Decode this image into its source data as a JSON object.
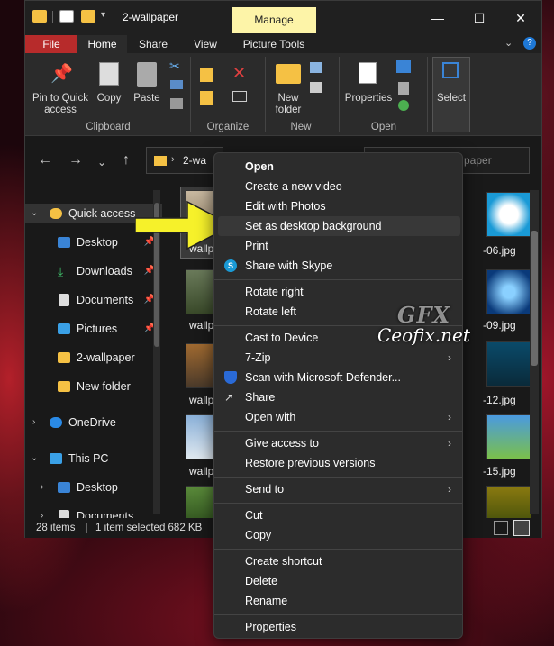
{
  "window": {
    "title": "2-wallpaper",
    "contextual_tab": "Manage"
  },
  "tabs": [
    "File",
    "Home",
    "Share",
    "View",
    "Picture Tools"
  ],
  "ribbon": {
    "pin": "Pin to Quick\naccess",
    "copy": "Copy",
    "paste": "Paste",
    "new_folder": "New\nfolder",
    "properties": "Properties",
    "select": "Select",
    "groups": {
      "clipboard": "Clipboard",
      "organize": "Organize",
      "new": "New",
      "open": "Open"
    }
  },
  "address": {
    "path_segment": "2-wa",
    "search_placeholder": "paper"
  },
  "nav": {
    "quick_access": "Quick access",
    "desktop": "Desktop",
    "downloads": "Downloads",
    "documents": "Documents",
    "pictures": "Pictures",
    "wallpaper": "2-wallpaper",
    "new_folder": "New folder",
    "onedrive": "OneDrive",
    "this_pc": "This PC",
    "desktop2": "Desktop",
    "documents2": "Documents"
  },
  "files": {
    "left": [
      "wallp",
      "wallp",
      "wallp",
      "wallp"
    ],
    "right": [
      "-06.jpg",
      "-09.jpg",
      "-12.jpg",
      "-15.jpg"
    ]
  },
  "status": {
    "count": "28 items",
    "selected": "1 item selected  682 KB"
  },
  "context_menu": {
    "open": "Open",
    "create_video": "Create a new video",
    "edit_photos": "Edit with Photos",
    "set_bg": "Set as desktop background",
    "print": "Print",
    "share_skype": "Share with Skype",
    "rotate_right": "Rotate right",
    "rotate_left": "Rotate left",
    "cast": "Cast to Device",
    "zip": "7-Zip",
    "defender": "Scan with Microsoft Defender...",
    "share": "Share",
    "open_with": "Open with",
    "give_access": "Give access to",
    "restore": "Restore previous versions",
    "send_to": "Send to",
    "cut": "Cut",
    "copy": "Copy",
    "create_shortcut": "Create shortcut",
    "delete": "Delete",
    "rename": "Rename",
    "properties": "Properties"
  },
  "watermark": {
    "logo": "GFX",
    "text": "Ceofix.net"
  },
  "colors": {
    "accent_file_tab": "#b72b2b",
    "manage_tab": "#fdf4a8",
    "folder": "#f5c144",
    "arrow": "#f6f12a"
  }
}
